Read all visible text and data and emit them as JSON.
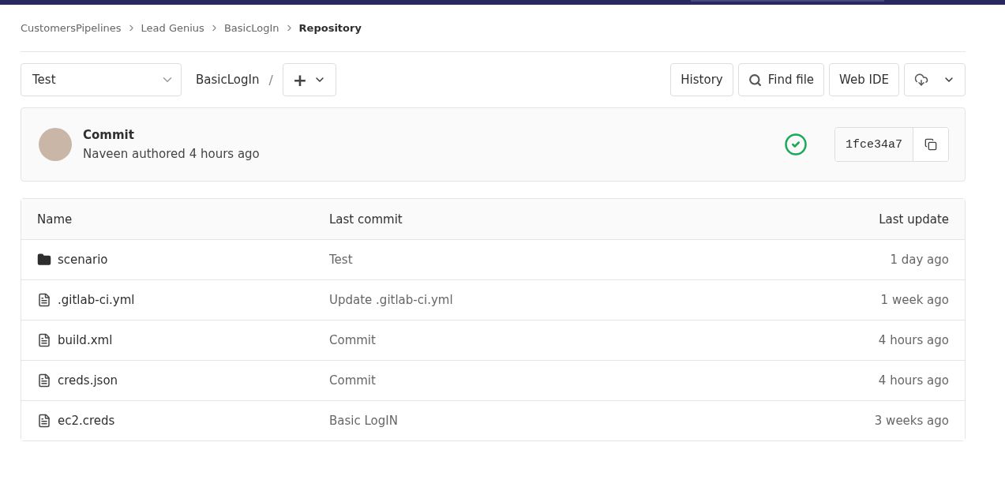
{
  "breadcrumbs": [
    {
      "label": "CustomersPipelines",
      "current": false
    },
    {
      "label": "Lead Genius",
      "current": false
    },
    {
      "label": "BasicLogIn",
      "current": false
    },
    {
      "label": "Repository",
      "current": true
    }
  ],
  "toolbar": {
    "branch": "Test",
    "path": "BasicLogIn",
    "separator": "/",
    "add": "+",
    "buttons": [
      "History",
      "Find file",
      "Web IDE"
    ]
  },
  "commit": {
    "title": "Commit",
    "author": "Naveen authored 4 hours ago",
    "pipeline_passed": true,
    "sha": "1fce34a7"
  },
  "table": {
    "columns": [
      "Name",
      "Last commit",
      "Last update"
    ],
    "rows": [
      {
        "kind": "folder",
        "name": "scenario",
        "commit": "Test",
        "updated": "1 day ago"
      },
      {
        "kind": "file",
        "name": ".gitlab-ci.yml",
        "commit": "Update .gitlab-ci.yml",
        "updated": "1 week ago"
      },
      {
        "kind": "file",
        "name": "build.xml",
        "commit": "Commit",
        "updated": "4 hours ago"
      },
      {
        "kind": "file",
        "name": "creds.json",
        "commit": "Commit",
        "updated": "4 hours ago"
      },
      {
        "kind": "file",
        "name": "ec2.creds",
        "commit": "Basic LogIN",
        "updated": "3 weeks ago"
      }
    ]
  }
}
